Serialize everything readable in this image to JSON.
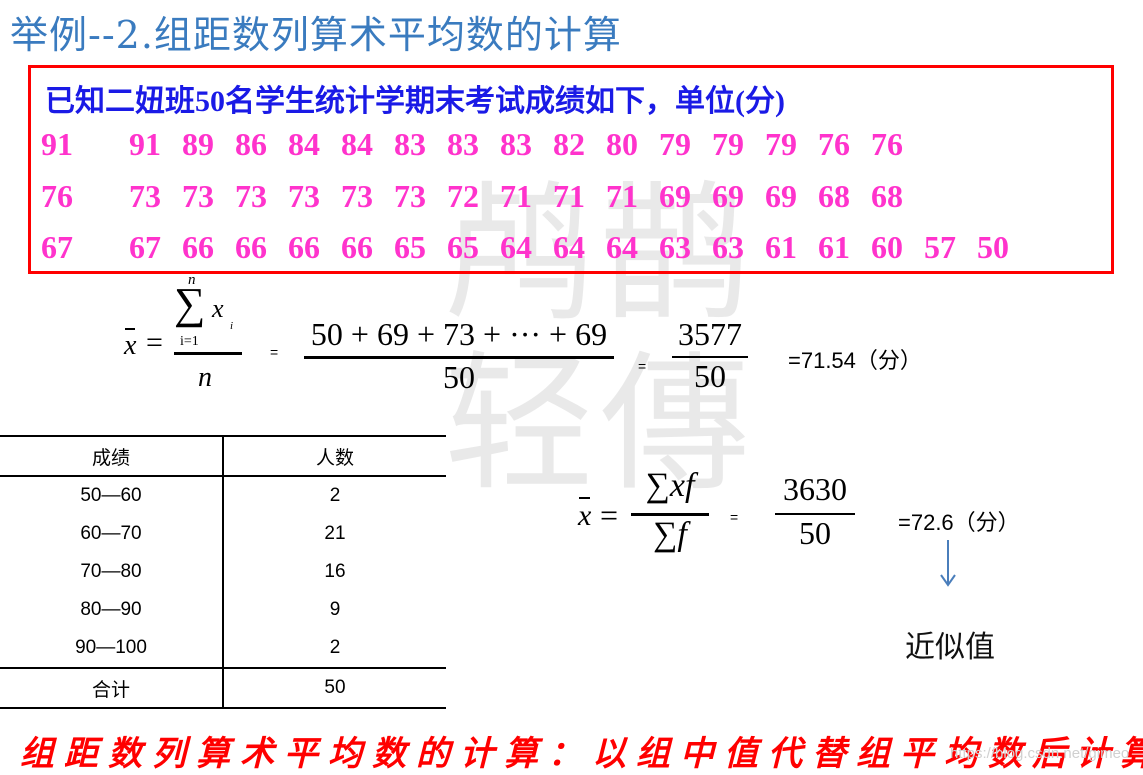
{
  "title": "举例--2.组距数列算术平均数的计算",
  "problem": {
    "intro": "已知二妞班50名学生统计学期末考试成绩如下，单位(分)",
    "scores": [
      [
        "91",
        "91",
        "89",
        "86",
        "84",
        "84",
        "83",
        "83",
        "83",
        "82",
        "80",
        "79",
        "79",
        "79",
        "76",
        "76"
      ],
      [
        "76",
        "73",
        "73",
        "73",
        "73",
        "73",
        "73",
        "72",
        "71",
        "71",
        "71",
        "69",
        "69",
        "69",
        "68",
        "68"
      ],
      [
        "67",
        "67",
        "66",
        "66",
        "66",
        "66",
        "65",
        "65",
        "64",
        "64",
        "64",
        "63",
        "63",
        "61",
        "61",
        "60",
        "57",
        "50"
      ]
    ]
  },
  "formula1": {
    "lhs": "x",
    "eq": "=",
    "sum_top": "n",
    "sum_symbol": "∑",
    "sum_var": "x",
    "sum_sub": "i",
    "sum_bottom": "i=1",
    "denominator": "n",
    "eq_small": "=",
    "expanded_num": "50 + 69 + 73 + ··· + 69",
    "expanded_den": "50",
    "eq_small2": "=",
    "total_num": "3577",
    "total_den": "50",
    "result": "=71.54（分）"
  },
  "table": {
    "headers": [
      "成绩",
      "人数"
    ],
    "rows": [
      [
        "50—60",
        "2"
      ],
      [
        "60—70",
        "21"
      ],
      [
        "70—80",
        "16"
      ],
      [
        "80—90",
        "9"
      ],
      [
        "90—100",
        "2"
      ]
    ],
    "total": [
      "合计",
      "50"
    ]
  },
  "formula2": {
    "lhs": "x",
    "eq": "=",
    "numerator": "∑xf",
    "denominator": "∑f",
    "eq_small": "=",
    "total_num": "3630",
    "total_den": "50",
    "result": "=72.6（分）",
    "approx_label": "近似值",
    "arrow_icon": "arrow-down-icon"
  },
  "summary": "组距数列算术平均数的计算：以组中值代替组平均数后计算。",
  "watermark_text": "https://blog.csdn.net/gimeo",
  "colors": {
    "title": "#3a7bbf",
    "intro": "#1a1ae6",
    "scores": "#ff33cc",
    "box_border": "#ff0000",
    "summary": "#ff0000",
    "arrow": "#4a7ebb"
  }
}
